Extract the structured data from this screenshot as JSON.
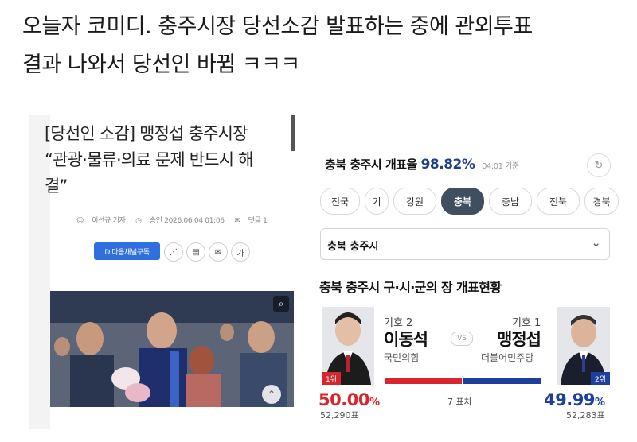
{
  "caption": {
    "line1": "오늘자 코미디. 충주시장 당선소감 발표하는 중에 관외투표",
    "line2": "결과 나와서 당선인 바뀜 ㅋㅋㅋ"
  },
  "article": {
    "headline_line1": "[당선인 소감] 맹정섭 충주시장",
    "headline_line2": "“관광·물류·의료 문제 반드시 해",
    "headline_line3": "결”",
    "reporter": "이선규 기자",
    "approved": "승인 2026.06.04 01:06",
    "comments": "댓글 1",
    "subscribe_label": "D 다음채널구독",
    "font_size_label": "가"
  },
  "election": {
    "title_prefix": "충북 충주시 개표율",
    "rate": "98.82%",
    "time": "04:01 기준",
    "tabs": [
      "전국",
      "기",
      "강원",
      "충북",
      "충남",
      "전북",
      "경북"
    ],
    "active_tab": "충북",
    "select_value": "충북 충주시",
    "section_title": "충북 충주시 구·시·군의 장 개표현황",
    "vs": "VS",
    "diff": "7 표차",
    "left": {
      "no": "기호 2",
      "name": "이동석",
      "party": "국민의힘",
      "rank": "1위",
      "pct": "50.00",
      "votes": "52,290표",
      "color": "#d7262e"
    },
    "right": {
      "no": "기호 1",
      "name": "맹정섭",
      "party": "더불어민주당",
      "rank": "2위",
      "pct": "49.99",
      "votes": "52,283표",
      "color": "#1e3fa0"
    },
    "pct_unit": "%"
  }
}
